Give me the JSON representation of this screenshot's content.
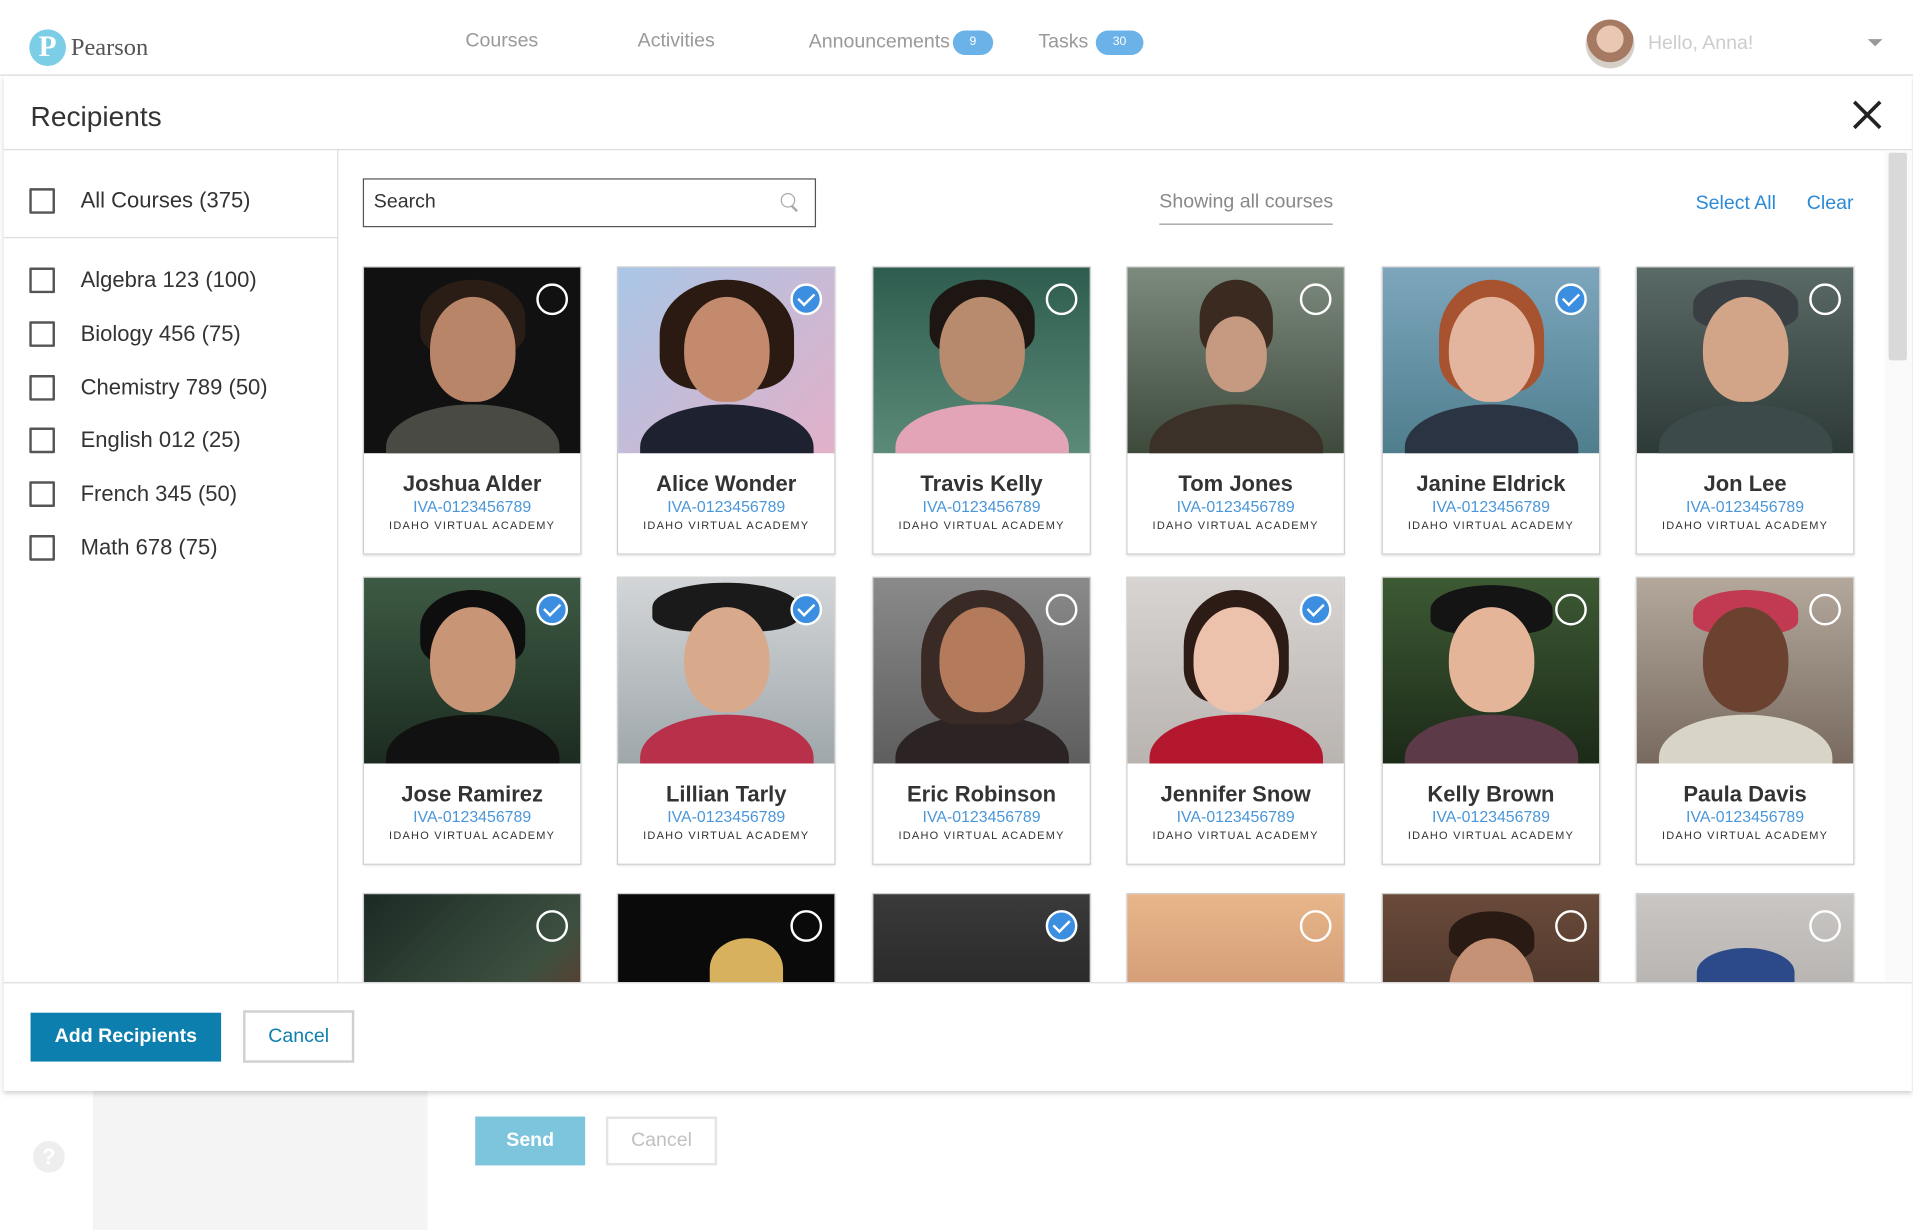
{
  "nav": {
    "brand": "Pearson",
    "logo_letter": "P",
    "items": [
      {
        "label": "Courses"
      },
      {
        "label": "Activities"
      },
      {
        "label": "Announcements",
        "badge": "9"
      },
      {
        "label": "Tasks",
        "badge": "30"
      }
    ],
    "greeting": "Hello, Anna!"
  },
  "modal": {
    "title": "Recipients",
    "all_courses": {
      "label": "All Courses (375)",
      "checked": false
    },
    "courses": [
      {
        "label": "Algebra 123 (100)",
        "checked": false
      },
      {
        "label": "Biology 456 (75)",
        "checked": false
      },
      {
        "label": "Chemistry 789 (50)",
        "checked": false
      },
      {
        "label": "English 012 (25)",
        "checked": false
      },
      {
        "label": "French 345 (50)",
        "checked": false
      },
      {
        "label": "Math 678 (75)",
        "checked": false
      }
    ],
    "search_placeholder": "Search",
    "showing": "Showing all courses",
    "select_all": "Select All",
    "clear": "Clear",
    "students": [
      {
        "name": "Joshua Alder",
        "id": "IVA-0123456789",
        "school": "IDAHO VIRTUAL ACADEMY",
        "selected": false
      },
      {
        "name": "Alice Wonder",
        "id": "IVA-0123456789",
        "school": "IDAHO VIRTUAL ACADEMY",
        "selected": true
      },
      {
        "name": "Travis Kelly",
        "id": "IVA-0123456789",
        "school": "IDAHO VIRTUAL ACADEMY",
        "selected": false
      },
      {
        "name": "Tom Jones",
        "id": "IVA-0123456789",
        "school": "IDAHO VIRTUAL ACADEMY",
        "selected": false
      },
      {
        "name": "Janine Eldrick",
        "id": "IVA-0123456789",
        "school": "IDAHO VIRTUAL ACADEMY",
        "selected": true
      },
      {
        "name": "Jon Lee",
        "id": "IVA-0123456789",
        "school": "IDAHO VIRTUAL ACADEMY",
        "selected": false
      },
      {
        "name": "Jose Ramirez",
        "id": "IVA-0123456789",
        "school": "IDAHO VIRTUAL ACADEMY",
        "selected": true
      },
      {
        "name": "Lillian Tarly",
        "id": "IVA-0123456789",
        "school": "IDAHO VIRTUAL ACADEMY",
        "selected": true
      },
      {
        "name": "Eric Robinson",
        "id": "IVA-0123456789",
        "school": "IDAHO VIRTUAL ACADEMY",
        "selected": false
      },
      {
        "name": "Jennifer Snow",
        "id": "IVA-0123456789",
        "school": "IDAHO VIRTUAL ACADEMY",
        "selected": true
      },
      {
        "name": "Kelly Brown",
        "id": "IVA-0123456789",
        "school": "IDAHO VIRTUAL ACADEMY",
        "selected": false
      },
      {
        "name": "Paula Davis",
        "id": "IVA-0123456789",
        "school": "IDAHO VIRTUAL ACADEMY",
        "selected": false
      },
      {
        "name": "",
        "id": "",
        "school": "",
        "selected": false
      },
      {
        "name": "",
        "id": "",
        "school": "",
        "selected": false
      },
      {
        "name": "",
        "id": "",
        "school": "",
        "selected": true
      },
      {
        "name": "",
        "id": "",
        "school": "",
        "selected": false
      },
      {
        "name": "",
        "id": "",
        "school": "",
        "selected": false
      },
      {
        "name": "",
        "id": "",
        "school": "",
        "selected": false
      }
    ],
    "add_label": "Add Recipients",
    "cancel_label": "Cancel"
  },
  "page": {
    "help_glyph": "?",
    "send_label": "Send",
    "cancel_label": "Cancel"
  },
  "colors": {
    "accent": "#0d7fae",
    "link": "#2b8ad7",
    "check": "#3b8ee0",
    "badge": "#6bb2e8"
  }
}
